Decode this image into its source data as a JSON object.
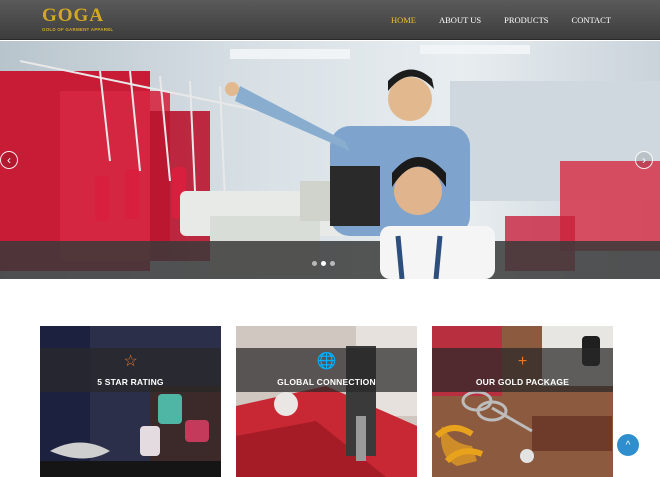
{
  "header": {
    "logo_text": "GOGA",
    "logo_tagline": "GOLD OF GARMENT APPAREL",
    "nav": [
      {
        "label": "HOME",
        "active": true
      },
      {
        "label": "ABOUT US",
        "active": false
      },
      {
        "label": "PRODUCTS",
        "active": false
      },
      {
        "label": "CONTACT",
        "active": false
      }
    ]
  },
  "hero": {
    "prev_icon": "chevron-left-icon",
    "next_icon": "chevron-right-icon",
    "prev_glyph": "‹",
    "next_glyph": "›",
    "slide_count": 3,
    "active_slide": 1
  },
  "cards": [
    {
      "title": "5 STAR RATING",
      "icon": "star-outline-icon",
      "glyph": "☆"
    },
    {
      "title": "GLOBAL CONNECTION",
      "icon": "globe-icon",
      "glyph": "🌐"
    },
    {
      "title": "OUR GOLD PACKAGE",
      "icon": "plus-icon",
      "glyph": "+"
    }
  ],
  "colors": {
    "accent_gold": "#e8c22f",
    "icon_orange": "#e8772e",
    "header_bg": "#4a4a4a",
    "scroll_button": "#2f8fce"
  },
  "scroll_top_glyph": "^"
}
